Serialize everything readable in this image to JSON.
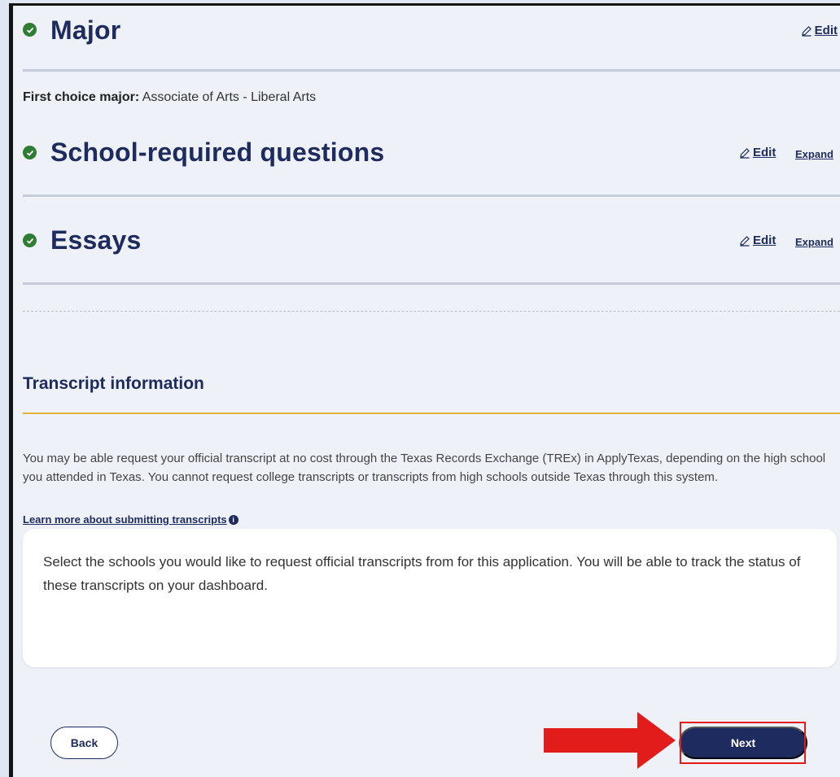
{
  "sections": [
    {
      "title": "Major",
      "edit": "Edit",
      "expand": null
    },
    {
      "title": "School-required questions",
      "edit": "Edit",
      "expand": "Expand"
    },
    {
      "title": "Essays",
      "edit": "Edit",
      "expand": "Expand"
    }
  ],
  "major": {
    "label": "First choice major:",
    "value": "Associate of Arts - Liberal Arts"
  },
  "transcript": {
    "title": "Transcript information",
    "description": "You may be able request your official transcript at no cost through the Texas Records Exchange (TREx) in ApplyTexas, depending on the high school you attended in Texas. You cannot request college transcripts or transcripts from high schools outside Texas through this system.",
    "learn_more": "Learn more about submitting transcripts",
    "select_text": "Select the schools you would like to request official transcripts from for this application. You will be able to track the status of these transcripts on your dashboard."
  },
  "buttons": {
    "back": "Back",
    "next": "Next"
  },
  "icons": {
    "check": "check-circle-icon",
    "edit": "pencil-edit-icon",
    "info": "info-icon",
    "arrow": "red-arrow-icon"
  },
  "colors": {
    "navy": "#1d2b5e",
    "green": "#2f7d32",
    "gold": "#e0b33a",
    "highlight": "#e21b1b"
  }
}
